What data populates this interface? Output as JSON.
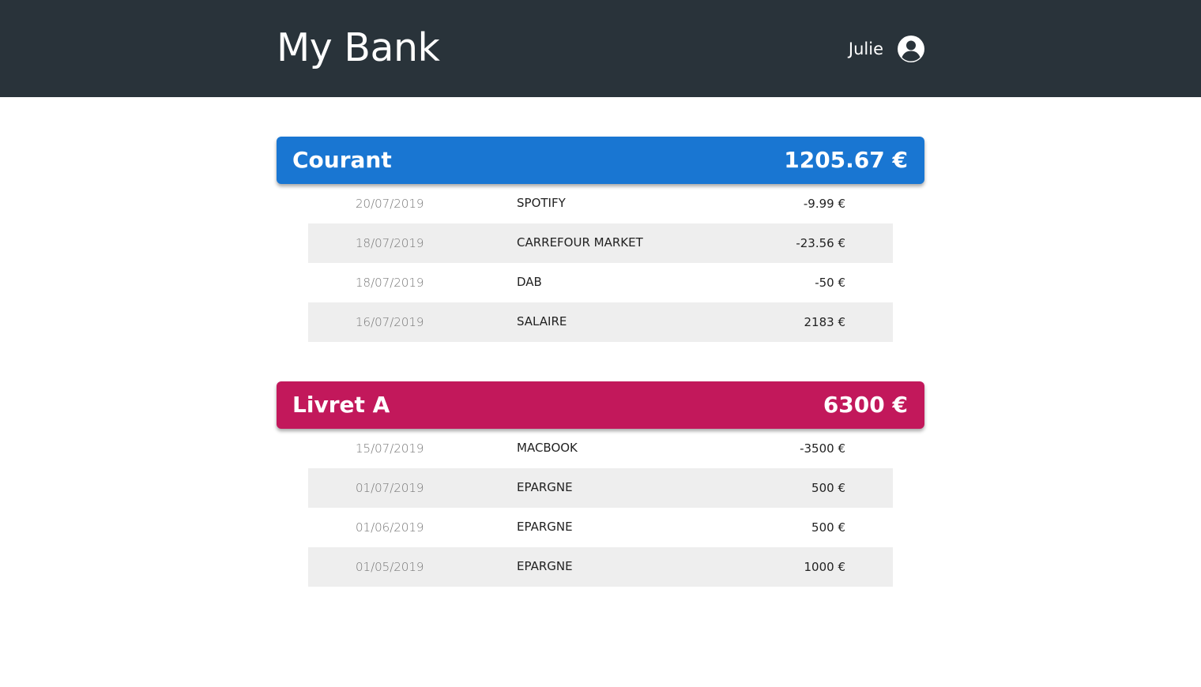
{
  "header": {
    "title": "My Bank",
    "user_name": "Julie",
    "user_icon": "user-circle-icon"
  },
  "colors": {
    "header_bg": "#29333a",
    "courant": "#1976d2",
    "livret": "#c2185b",
    "row_alt": "#eeeeee"
  },
  "accounts": [
    {
      "name": "Courant",
      "balance": "1205.67 €",
      "transactions": [
        {
          "date": "20/07/2019",
          "label": "SPOTIFY",
          "amount": "-9.99 €"
        },
        {
          "date": "18/07/2019",
          "label": "CARREFOUR MARKET",
          "amount": "-23.56 €"
        },
        {
          "date": "18/07/2019",
          "label": "DAB",
          "amount": "-50 €"
        },
        {
          "date": "16/07/2019",
          "label": "SALAIRE",
          "amount": "2183 €"
        }
      ]
    },
    {
      "name": "Livret A",
      "balance": "6300 €",
      "transactions": [
        {
          "date": "15/07/2019",
          "label": "MACBOOK",
          "amount": "-3500 €"
        },
        {
          "date": "01/07/2019",
          "label": "EPARGNE",
          "amount": "500 €"
        },
        {
          "date": "01/06/2019",
          "label": "EPARGNE",
          "amount": "500 €"
        },
        {
          "date": "01/05/2019",
          "label": "EPARGNE",
          "amount": "1000 €"
        }
      ]
    }
  ]
}
